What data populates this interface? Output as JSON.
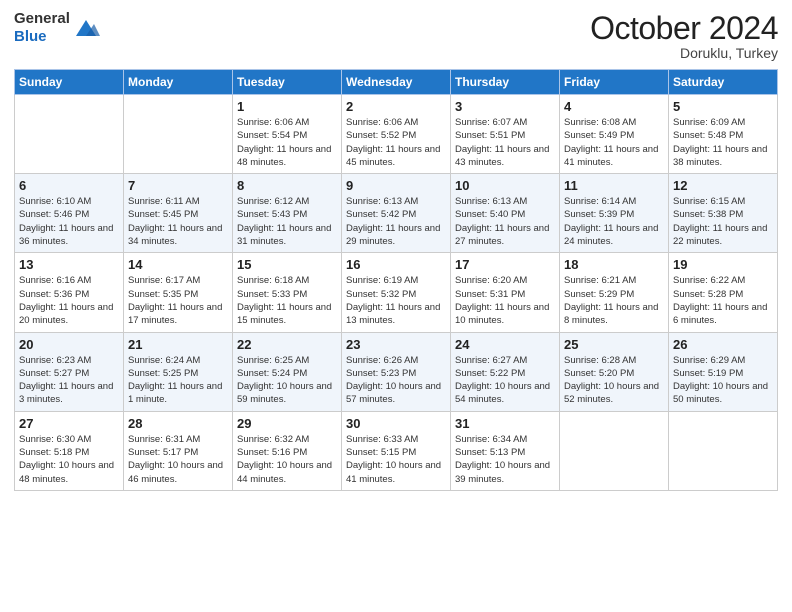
{
  "header": {
    "logo_line1": "General",
    "logo_line2": "Blue",
    "month": "October 2024",
    "location": "Doruklu, Turkey"
  },
  "weekdays": [
    "Sunday",
    "Monday",
    "Tuesday",
    "Wednesday",
    "Thursday",
    "Friday",
    "Saturday"
  ],
  "weeks": [
    [
      {
        "day": "",
        "info": ""
      },
      {
        "day": "",
        "info": ""
      },
      {
        "day": "1",
        "info": "Sunrise: 6:06 AM\nSunset: 5:54 PM\nDaylight: 11 hours and 48 minutes."
      },
      {
        "day": "2",
        "info": "Sunrise: 6:06 AM\nSunset: 5:52 PM\nDaylight: 11 hours and 45 minutes."
      },
      {
        "day": "3",
        "info": "Sunrise: 6:07 AM\nSunset: 5:51 PM\nDaylight: 11 hours and 43 minutes."
      },
      {
        "day": "4",
        "info": "Sunrise: 6:08 AM\nSunset: 5:49 PM\nDaylight: 11 hours and 41 minutes."
      },
      {
        "day": "5",
        "info": "Sunrise: 6:09 AM\nSunset: 5:48 PM\nDaylight: 11 hours and 38 minutes."
      }
    ],
    [
      {
        "day": "6",
        "info": "Sunrise: 6:10 AM\nSunset: 5:46 PM\nDaylight: 11 hours and 36 minutes."
      },
      {
        "day": "7",
        "info": "Sunrise: 6:11 AM\nSunset: 5:45 PM\nDaylight: 11 hours and 34 minutes."
      },
      {
        "day": "8",
        "info": "Sunrise: 6:12 AM\nSunset: 5:43 PM\nDaylight: 11 hours and 31 minutes."
      },
      {
        "day": "9",
        "info": "Sunrise: 6:13 AM\nSunset: 5:42 PM\nDaylight: 11 hours and 29 minutes."
      },
      {
        "day": "10",
        "info": "Sunrise: 6:13 AM\nSunset: 5:40 PM\nDaylight: 11 hours and 27 minutes."
      },
      {
        "day": "11",
        "info": "Sunrise: 6:14 AM\nSunset: 5:39 PM\nDaylight: 11 hours and 24 minutes."
      },
      {
        "day": "12",
        "info": "Sunrise: 6:15 AM\nSunset: 5:38 PM\nDaylight: 11 hours and 22 minutes."
      }
    ],
    [
      {
        "day": "13",
        "info": "Sunrise: 6:16 AM\nSunset: 5:36 PM\nDaylight: 11 hours and 20 minutes."
      },
      {
        "day": "14",
        "info": "Sunrise: 6:17 AM\nSunset: 5:35 PM\nDaylight: 11 hours and 17 minutes."
      },
      {
        "day": "15",
        "info": "Sunrise: 6:18 AM\nSunset: 5:33 PM\nDaylight: 11 hours and 15 minutes."
      },
      {
        "day": "16",
        "info": "Sunrise: 6:19 AM\nSunset: 5:32 PM\nDaylight: 11 hours and 13 minutes."
      },
      {
        "day": "17",
        "info": "Sunrise: 6:20 AM\nSunset: 5:31 PM\nDaylight: 11 hours and 10 minutes."
      },
      {
        "day": "18",
        "info": "Sunrise: 6:21 AM\nSunset: 5:29 PM\nDaylight: 11 hours and 8 minutes."
      },
      {
        "day": "19",
        "info": "Sunrise: 6:22 AM\nSunset: 5:28 PM\nDaylight: 11 hours and 6 minutes."
      }
    ],
    [
      {
        "day": "20",
        "info": "Sunrise: 6:23 AM\nSunset: 5:27 PM\nDaylight: 11 hours and 3 minutes."
      },
      {
        "day": "21",
        "info": "Sunrise: 6:24 AM\nSunset: 5:25 PM\nDaylight: 11 hours and 1 minute."
      },
      {
        "day": "22",
        "info": "Sunrise: 6:25 AM\nSunset: 5:24 PM\nDaylight: 10 hours and 59 minutes."
      },
      {
        "day": "23",
        "info": "Sunrise: 6:26 AM\nSunset: 5:23 PM\nDaylight: 10 hours and 57 minutes."
      },
      {
        "day": "24",
        "info": "Sunrise: 6:27 AM\nSunset: 5:22 PM\nDaylight: 10 hours and 54 minutes."
      },
      {
        "day": "25",
        "info": "Sunrise: 6:28 AM\nSunset: 5:20 PM\nDaylight: 10 hours and 52 minutes."
      },
      {
        "day": "26",
        "info": "Sunrise: 6:29 AM\nSunset: 5:19 PM\nDaylight: 10 hours and 50 minutes."
      }
    ],
    [
      {
        "day": "27",
        "info": "Sunrise: 6:30 AM\nSunset: 5:18 PM\nDaylight: 10 hours and 48 minutes."
      },
      {
        "day": "28",
        "info": "Sunrise: 6:31 AM\nSunset: 5:17 PM\nDaylight: 10 hours and 46 minutes."
      },
      {
        "day": "29",
        "info": "Sunrise: 6:32 AM\nSunset: 5:16 PM\nDaylight: 10 hours and 44 minutes."
      },
      {
        "day": "30",
        "info": "Sunrise: 6:33 AM\nSunset: 5:15 PM\nDaylight: 10 hours and 41 minutes."
      },
      {
        "day": "31",
        "info": "Sunrise: 6:34 AM\nSunset: 5:13 PM\nDaylight: 10 hours and 39 minutes."
      },
      {
        "day": "",
        "info": ""
      },
      {
        "day": "",
        "info": ""
      }
    ]
  ]
}
